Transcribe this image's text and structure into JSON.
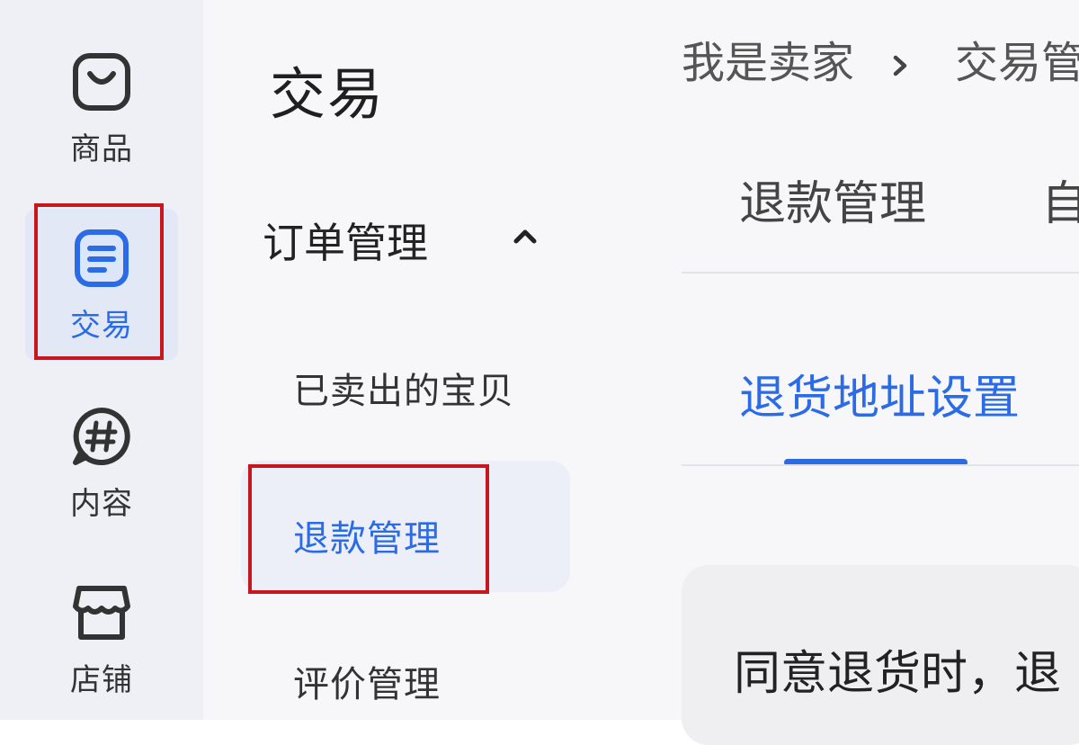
{
  "rail": {
    "items": [
      {
        "label": "商品",
        "icon": "shopping-bag-icon"
      },
      {
        "label": "交易",
        "icon": "document-list-icon"
      },
      {
        "label": "内容",
        "icon": "hashtag-chat-icon"
      },
      {
        "label": "店铺",
        "icon": "storefront-icon"
      }
    ]
  },
  "menu": {
    "title": "交易",
    "group_label": "订单管理",
    "items": [
      {
        "label": "已卖出的宝贝"
      },
      {
        "label": "退款管理"
      },
      {
        "label": "评价管理"
      }
    ]
  },
  "main": {
    "breadcrumb": {
      "root": "我是卖家",
      "current": "交易管"
    },
    "tabs": [
      {
        "label": "退款管理"
      },
      {
        "label": "自"
      }
    ],
    "subtab": {
      "label": "退货地址设置"
    },
    "card_text": "同意退货时，退"
  },
  "colors": {
    "accent": "#2b6be6",
    "highlight_border": "#c8161e",
    "rail_bg": "#eef0f6",
    "menu_bg": "#f7f7f9"
  }
}
